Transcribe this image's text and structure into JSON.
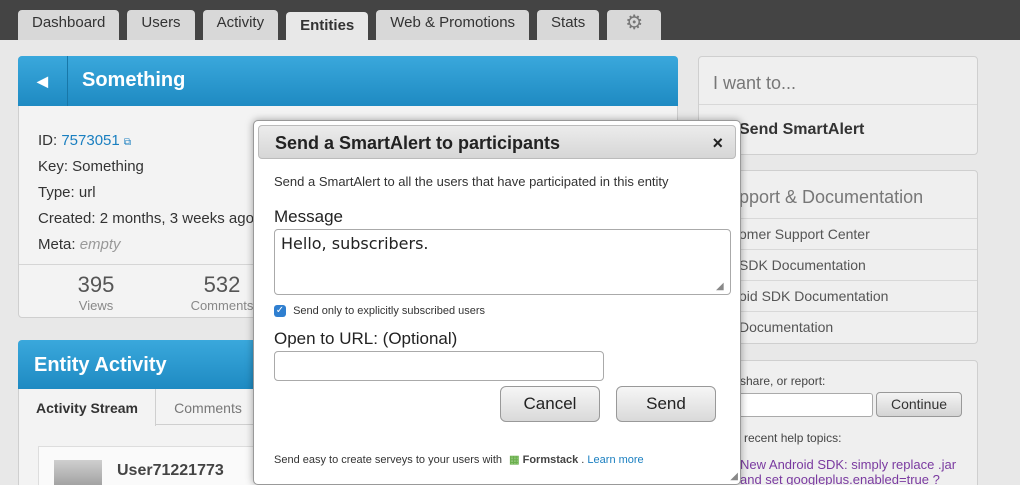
{
  "nav": {
    "tabs": [
      "Dashboard",
      "Users",
      "Activity",
      "Entities",
      "Web & Promotions",
      "Stats"
    ],
    "active": "Entities",
    "gear_glyph": "⚙"
  },
  "entity": {
    "title": "Something",
    "id_label": "ID:",
    "id_value": "7573051",
    "key": "Key: Something",
    "type": "Type: url",
    "created": "Created: 2 months, 3 weeks ago",
    "meta_label": "Meta:",
    "meta_value": "empty",
    "stats": [
      {
        "value": "395",
        "label": "Views"
      },
      {
        "value": "532",
        "label": "Comments"
      }
    ]
  },
  "activity": {
    "title": "Entity Activity",
    "tabs": [
      "Activity Stream",
      "Comments"
    ],
    "user": "User71221773"
  },
  "sidebar": {
    "want_title": "I want to...",
    "want_item": "Send SmartAlert",
    "support_title": "pport & Documentation",
    "support_items": [
      "omer Support Center",
      "SDK Documentation",
      "oid SDK Documentation",
      "Documentation"
    ],
    "report_label": "share, or report:",
    "continue_label": "Continue",
    "recent_label": "e recent help topics:",
    "topic_line1": "New Android SDK: simply replace .jar",
    "topic_line2": "and set googleplus.enabled=true ?"
  },
  "modal": {
    "title": "Send a SmartAlert to participants",
    "close": "×",
    "description": "Send a SmartAlert to all the users that have participated in this entity",
    "message_label": "Message",
    "message_value": "Hello, subscribers.",
    "checkbox_label": "Send only to explicitly subscribed users",
    "url_label": "Open to URL: (Optional)",
    "url_value": "",
    "cancel": "Cancel",
    "send": "Send",
    "footer_text": "Send easy to create serveys to your users with",
    "formstack": "Formstack",
    "learn_more": "Learn more"
  }
}
